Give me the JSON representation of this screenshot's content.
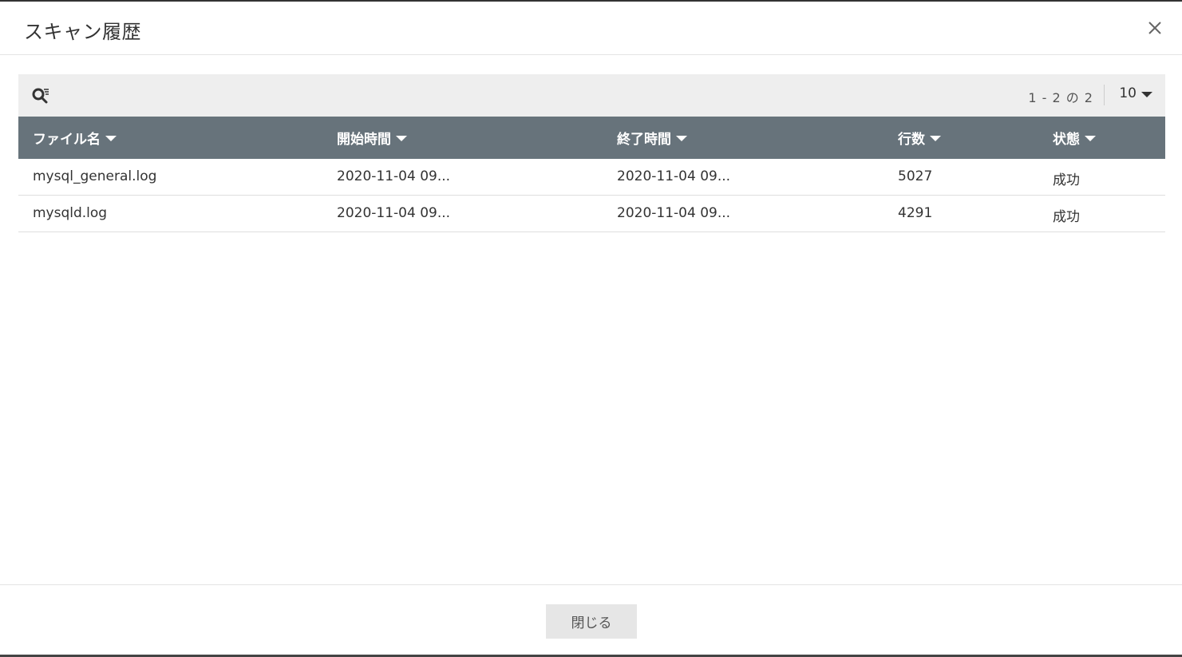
{
  "dialog": {
    "title": "スキャン履歴",
    "close_icon": "close-icon"
  },
  "toolbar": {
    "search_icon": "search-filter-icon",
    "pager_range": "1 - 2 の 2",
    "page_size": "10"
  },
  "table": {
    "columns": [
      "ファイル名",
      "開始時間",
      "終了時間",
      "行数",
      "状態"
    ],
    "rows": [
      [
        "mysql_general.log",
        "2020-11-04 09...",
        "2020-11-04 09...",
        "5027",
        "成功"
      ],
      [
        "mysqld.log",
        "2020-11-04 09...",
        "2020-11-04 09...",
        "4291",
        "成功"
      ]
    ]
  },
  "footer": {
    "close_label": "閉じる"
  },
  "colors": {
    "header_bg": "#67737b",
    "toolbar_bg": "#eeeeee",
    "button_bg": "#e6e6e6"
  }
}
